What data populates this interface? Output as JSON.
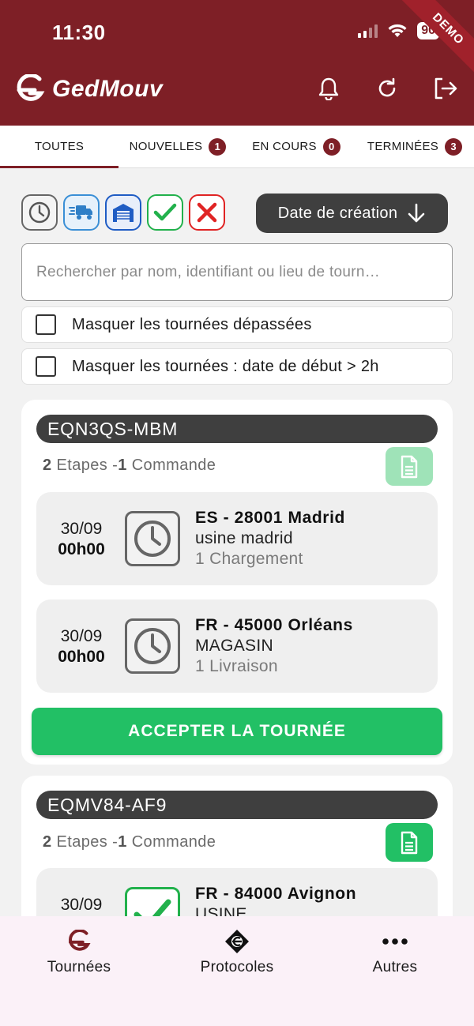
{
  "status_bar": {
    "time": "11:30",
    "battery": "90"
  },
  "ribbon": "DEMO",
  "app": {
    "name": "GedMouv"
  },
  "tabs": [
    {
      "label": "TOUTES",
      "badge": ""
    },
    {
      "label": "NOUVELLES",
      "badge": "1"
    },
    {
      "label": "EN COURS",
      "badge": "0"
    },
    {
      "label": "TERMINÉES",
      "badge": "3"
    }
  ],
  "filters": {
    "sort_label": "Date de création"
  },
  "search": {
    "placeholder": "Rechercher par nom, identifiant ou lieu de tourn…",
    "value": ""
  },
  "options": [
    {
      "label": "Masquer les tournées dépassées",
      "checked": false
    },
    {
      "label": "Masquer les tournées : date de début > 2h",
      "checked": false
    }
  ],
  "tours": [
    {
      "id": "EQN3QS-MBM",
      "steps_count": "2",
      "steps_label": "Etapes",
      "separator": "-",
      "orders_count": "1",
      "orders_label": "Commande",
      "stops": [
        {
          "date": "30/09",
          "time": "00h00",
          "status_icon": "clock-icon",
          "location": "ES - 28001 Madrid",
          "site": "usine madrid",
          "operation": "1 Chargement"
        },
        {
          "date": "30/09",
          "time": "00h00",
          "status_icon": "clock-icon",
          "location": "FR - 45000 Orléans",
          "site": "MAGASIN",
          "operation": "1 Livraison"
        }
      ],
      "accept_label": "ACCEPTER LA TOURNÉE"
    },
    {
      "id": "EQMV84-AF9",
      "steps_count": "2",
      "steps_label": "Etapes",
      "separator": "-",
      "orders_count": "1",
      "orders_label": "Commande",
      "stops": [
        {
          "date": "30/09",
          "time": "",
          "status_icon": "check-icon",
          "location": "FR - 84000 Avignon",
          "site": "USINE",
          "operation": ""
        }
      ]
    }
  ],
  "bottom_nav": [
    {
      "label": "Tournées",
      "icon": "gedmouv-logo-icon"
    },
    {
      "label": "Protocoles",
      "icon": "protocol-icon"
    },
    {
      "label": "Autres",
      "icon": "more-icon"
    }
  ],
  "colors": {
    "brand": "#7e1f26",
    "accept": "#22c065",
    "dark_pill": "#3f3f3f"
  }
}
